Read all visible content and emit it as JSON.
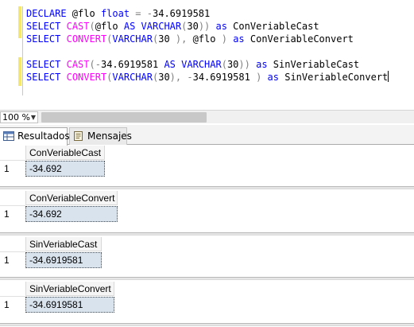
{
  "editor": {
    "lines": [
      {
        "segs": [
          [
            "kw",
            "DECLARE"
          ],
          [
            "tx",
            " @flo "
          ],
          [
            "kw",
            "float"
          ],
          [
            "tx",
            " "
          ],
          [
            "gy",
            "="
          ],
          [
            "tx",
            " "
          ],
          [
            "gy",
            "-"
          ],
          [
            "tx",
            "34.6919581"
          ]
        ]
      },
      {
        "segs": [
          [
            "kw",
            "SELECT"
          ],
          [
            "tx",
            " "
          ],
          [
            "fn",
            "CAST"
          ],
          [
            "gy",
            "("
          ],
          [
            "tx",
            "@flo "
          ],
          [
            "kw",
            "AS"
          ],
          [
            "tx",
            " "
          ],
          [
            "kw",
            "VARCHAR"
          ],
          [
            "gy",
            "("
          ],
          [
            "tx",
            "30"
          ],
          [
            "gy",
            "))"
          ],
          [
            "tx",
            " "
          ],
          [
            "kw",
            "as"
          ],
          [
            "tx",
            " ConVeriableCast"
          ]
        ]
      },
      {
        "segs": [
          [
            "kw",
            "SELECT"
          ],
          [
            "tx",
            " "
          ],
          [
            "fn",
            "CONVERT"
          ],
          [
            "gy",
            "("
          ],
          [
            "kw",
            "VARCHAR"
          ],
          [
            "gy",
            "("
          ],
          [
            "tx",
            "30"
          ],
          [
            "gy",
            " ),"
          ],
          [
            "tx",
            " @flo "
          ],
          [
            "gy",
            ")"
          ],
          [
            "tx",
            " "
          ],
          [
            "kw",
            "as"
          ],
          [
            "tx",
            " ConVeriableConvert"
          ]
        ]
      },
      {
        "segs": []
      },
      {
        "segs": [
          [
            "kw",
            "SELECT"
          ],
          [
            "tx",
            " "
          ],
          [
            "fn",
            "CAST"
          ],
          [
            "gy",
            "("
          ],
          [
            "gy",
            "-"
          ],
          [
            "tx",
            "34.6919581 "
          ],
          [
            "kw",
            "AS"
          ],
          [
            "tx",
            " "
          ],
          [
            "kw",
            "VARCHAR"
          ],
          [
            "gy",
            "("
          ],
          [
            "tx",
            "30"
          ],
          [
            "gy",
            "))"
          ],
          [
            "tx",
            " "
          ],
          [
            "kw",
            "as"
          ],
          [
            "tx",
            " SinVeriableCast"
          ]
        ]
      },
      {
        "segs": [
          [
            "kw",
            "SELECT"
          ],
          [
            "tx",
            " "
          ],
          [
            "fn",
            "CONVERT"
          ],
          [
            "gy",
            "("
          ],
          [
            "kw",
            "VARCHAR"
          ],
          [
            "gy",
            "("
          ],
          [
            "tx",
            "30"
          ],
          [
            "gy",
            "),"
          ],
          [
            "tx",
            " "
          ],
          [
            "gy",
            "-"
          ],
          [
            "tx",
            "34.6919581 "
          ],
          [
            "gy",
            ")"
          ],
          [
            "tx",
            " "
          ],
          [
            "kw",
            "as"
          ],
          [
            "tx",
            " SinVeriableConvert"
          ]
        ]
      }
    ]
  },
  "zoom": {
    "value": "100 %"
  },
  "tabs": {
    "results_label": "Resultados",
    "messages_label": "Mensajes"
  },
  "results": [
    {
      "column": "ConVeriableCast",
      "row_number": "1",
      "value": "-34.692"
    },
    {
      "column": "ConVeriableConvert",
      "row_number": "1",
      "value": "-34.692"
    },
    {
      "column": "SinVeriableCast",
      "row_number": "1",
      "value": "-34.6919581"
    },
    {
      "column": "SinVeriableConvert",
      "row_number": "1",
      "value": "-34.6919581"
    }
  ],
  "colors": {
    "keyword": "#0000ff",
    "function": "#ff00ff",
    "operator": "#808080",
    "selected_cell": "#d9e3ee"
  }
}
